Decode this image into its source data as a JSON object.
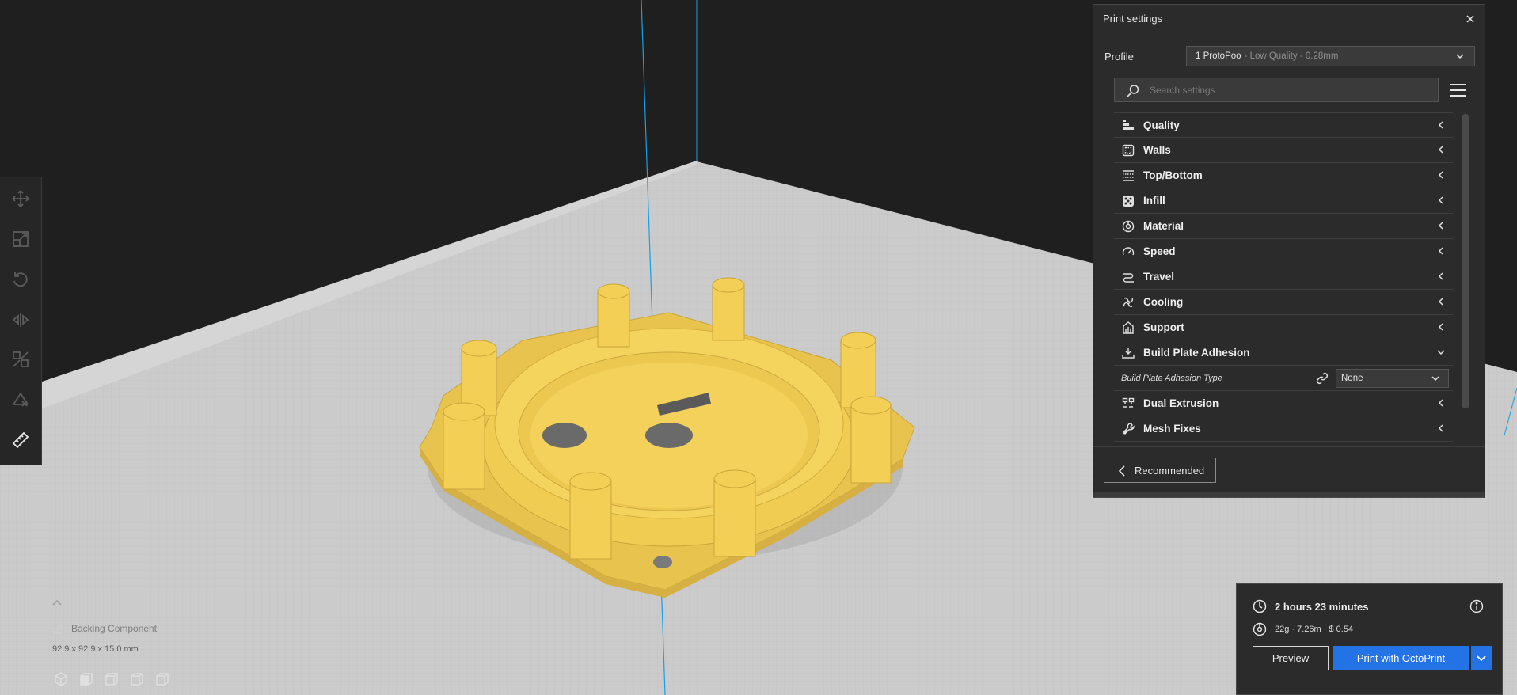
{
  "print_settings": {
    "title": "Print settings",
    "profile_label": "Profile",
    "profile_name": "1 ProtoPoo",
    "profile_detail": "- Low Quality - 0.28mm",
    "search_placeholder": "Search settings",
    "categories": [
      {
        "label": "Quality",
        "icon": "quality-icon",
        "expanded": false
      },
      {
        "label": "Walls",
        "icon": "walls-icon",
        "expanded": false
      },
      {
        "label": "Top/Bottom",
        "icon": "top-bottom-icon",
        "expanded": false
      },
      {
        "label": "Infill",
        "icon": "infill-icon",
        "expanded": false
      },
      {
        "label": "Material",
        "icon": "material-icon",
        "expanded": false
      },
      {
        "label": "Speed",
        "icon": "speed-icon",
        "expanded": false
      },
      {
        "label": "Travel",
        "icon": "travel-icon",
        "expanded": false
      },
      {
        "label": "Cooling",
        "icon": "cooling-icon",
        "expanded": false
      },
      {
        "label": "Support",
        "icon": "support-icon",
        "expanded": false
      },
      {
        "label": "Build Plate Adhesion",
        "icon": "build-plate-adhesion-icon",
        "expanded": true
      },
      {
        "label": "Dual Extrusion",
        "icon": "dual-extrusion-icon",
        "expanded": false
      },
      {
        "label": "Mesh Fixes",
        "icon": "mesh-fixes-icon",
        "expanded": false
      }
    ],
    "adhesion_setting": {
      "label": "Build Plate Adhesion Type",
      "value": "None"
    },
    "recommended_label": "Recommended"
  },
  "object": {
    "name": "Backing Component",
    "dimensions": "92.9 x 92.9 x 15.0 mm"
  },
  "estimate": {
    "time": "2 hours 23 minutes",
    "material": "22g · 7.26m · $ 0.54"
  },
  "actions": {
    "preview_label": "Preview",
    "print_label": "Print with OctoPrint"
  },
  "colors": {
    "accent": "#2473e6",
    "model": "#f4d35e",
    "build_plate": "#c8c8c8",
    "axis_line": "#1aa0e6",
    "background": "#1f1f1f"
  }
}
